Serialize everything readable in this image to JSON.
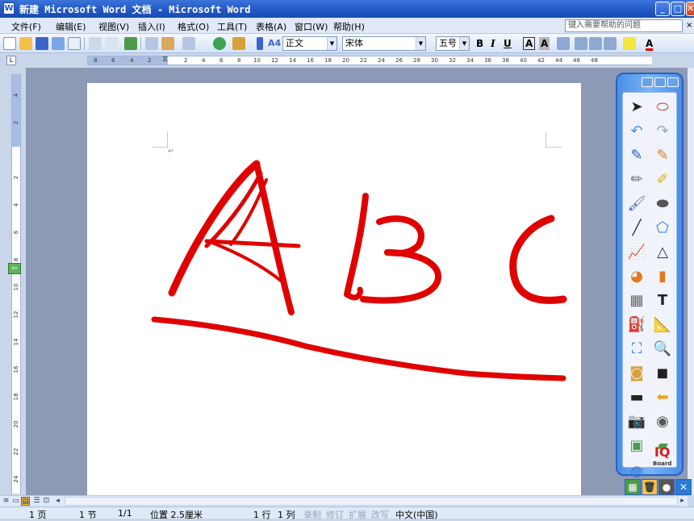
{
  "window": {
    "title": "新建 Microsoft Word 文档 - Microsoft Word",
    "doc_icon": "W",
    "buttons": [
      "_",
      "□",
      "✕"
    ]
  },
  "menu": [
    "文件(F)",
    "编辑(E)",
    "视图(V)",
    "插入(I)",
    "格式(O)",
    "工具(T)",
    "表格(A)",
    "窗口(W)",
    "帮助(H)"
  ],
  "help_box": {
    "placeholder": "键入需要帮助的问题",
    "close": "×"
  },
  "toolbar": {
    "style": "正文",
    "style_icon": "A4",
    "font": "宋体",
    "size": "五号",
    "bold": "B",
    "italic": "I",
    "underline": "U",
    "char_border": "A",
    "char_shade": "A",
    "font_color": "A"
  },
  "ruler": {
    "h_labels": [
      "8",
      "6",
      "4",
      "2",
      "2",
      "4",
      "6",
      "8",
      "10",
      "12",
      "14",
      "16",
      "18",
      "20",
      "22",
      "24",
      "26",
      "28",
      "30",
      "32",
      "34",
      "36",
      "38",
      "40",
      "42",
      "44",
      "46",
      "48"
    ],
    "v_labels": [
      "4",
      "2",
      "2",
      "4",
      "6",
      "8",
      "10",
      "12",
      "14",
      "16",
      "18",
      "20",
      "22",
      "24"
    ],
    "tab_selector": "L"
  },
  "document": {
    "paragraph_mark": "↵",
    "ink_text": "ABC",
    "ink_color": "#e00000"
  },
  "iq_panel": {
    "tools": [
      "pointer-arrow-icon",
      "mouse-icon",
      "undo-icon",
      "redo-icon",
      "pen-blue-icon",
      "pen-orange-icon",
      "pencil-icon",
      "highlighter-icon",
      "brush-icon",
      "eraser-icon",
      "line-icon",
      "polygon-icon",
      "chart-icon",
      "triangle-icon",
      "pie-chart-icon",
      "bar-chart-icon",
      "table-icon",
      "text-icon",
      "fill-icon",
      "ruler-icon",
      "screen-capture-icon",
      "magnifier-icon",
      "spotlight-icon",
      "comment-icon",
      "screen-icon",
      "arrow-left-icon",
      "camera-icon",
      "record-icon",
      "folder-icon",
      "cleaner-icon",
      "windows-icon"
    ],
    "logo": "IQ",
    "logo_sub": "Board"
  },
  "iq_bottom": [
    "▦",
    "🗑",
    "●",
    "✕"
  ],
  "status": {
    "page": "1 页",
    "section": "1 节",
    "pages": "1/1",
    "position": "位置 2.5厘米",
    "line": "1 行",
    "column": "1 列",
    "rec": "录制",
    "trk": "修订",
    "ext": "扩展",
    "ovr": "改写",
    "language": "中文(中国)"
  }
}
